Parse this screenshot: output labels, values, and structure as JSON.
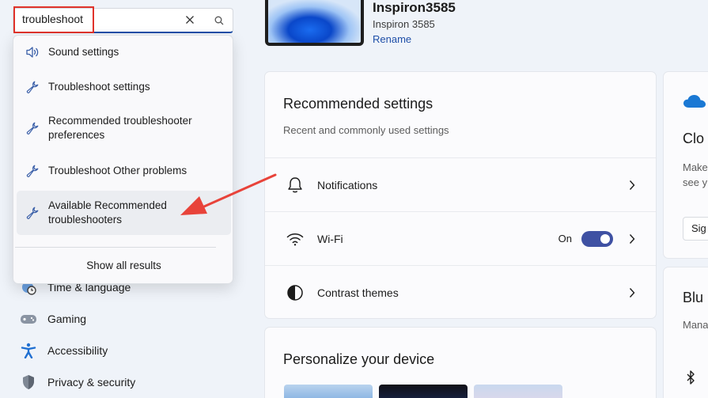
{
  "device": {
    "name": "Inspiron3585",
    "model": "Inspiron 3585",
    "rename_label": "Rename"
  },
  "search": {
    "query": "troubleshoot",
    "results": [
      {
        "label": "Sound settings",
        "icon": "speaker-icon"
      },
      {
        "label": "Troubleshoot settings",
        "icon": "wrench-icon"
      },
      {
        "label": "Recommended troubleshooter preferences",
        "icon": "wrench-icon"
      },
      {
        "label": "Troubleshoot Other problems",
        "icon": "wrench-icon"
      },
      {
        "label": "Available Recommended troubleshooters",
        "icon": "wrench-icon"
      }
    ],
    "show_all_label": "Show all results"
  },
  "nav": {
    "items": [
      {
        "label": "Time & language",
        "icon": "globe-clock-icon"
      },
      {
        "label": "Gaming",
        "icon": "gamepad-icon"
      },
      {
        "label": "Accessibility",
        "icon": "accessibility-icon"
      },
      {
        "label": "Privacy & security",
        "icon": "shield-icon"
      }
    ]
  },
  "recommended": {
    "title": "Recommended settings",
    "subtitle": "Recent and commonly used settings",
    "rows": [
      {
        "label": "Notifications",
        "icon": "bell-icon"
      },
      {
        "label": "Wi-Fi",
        "icon": "wifi-icon",
        "status": "On"
      },
      {
        "label": "Contrast themes",
        "icon": "contrast-icon"
      }
    ]
  },
  "personalize": {
    "title": "Personalize your device"
  },
  "cloud_card": {
    "title": "Clo",
    "text_line1": "Make",
    "text_line2": "see y",
    "button_label": "Sig"
  },
  "bluetooth_card": {
    "title": "Blu",
    "text": "Mana"
  },
  "colors": {
    "accent": "#1f4fa8",
    "toggle_on": "#3f51a3",
    "highlight_red": "#e0332b"
  }
}
